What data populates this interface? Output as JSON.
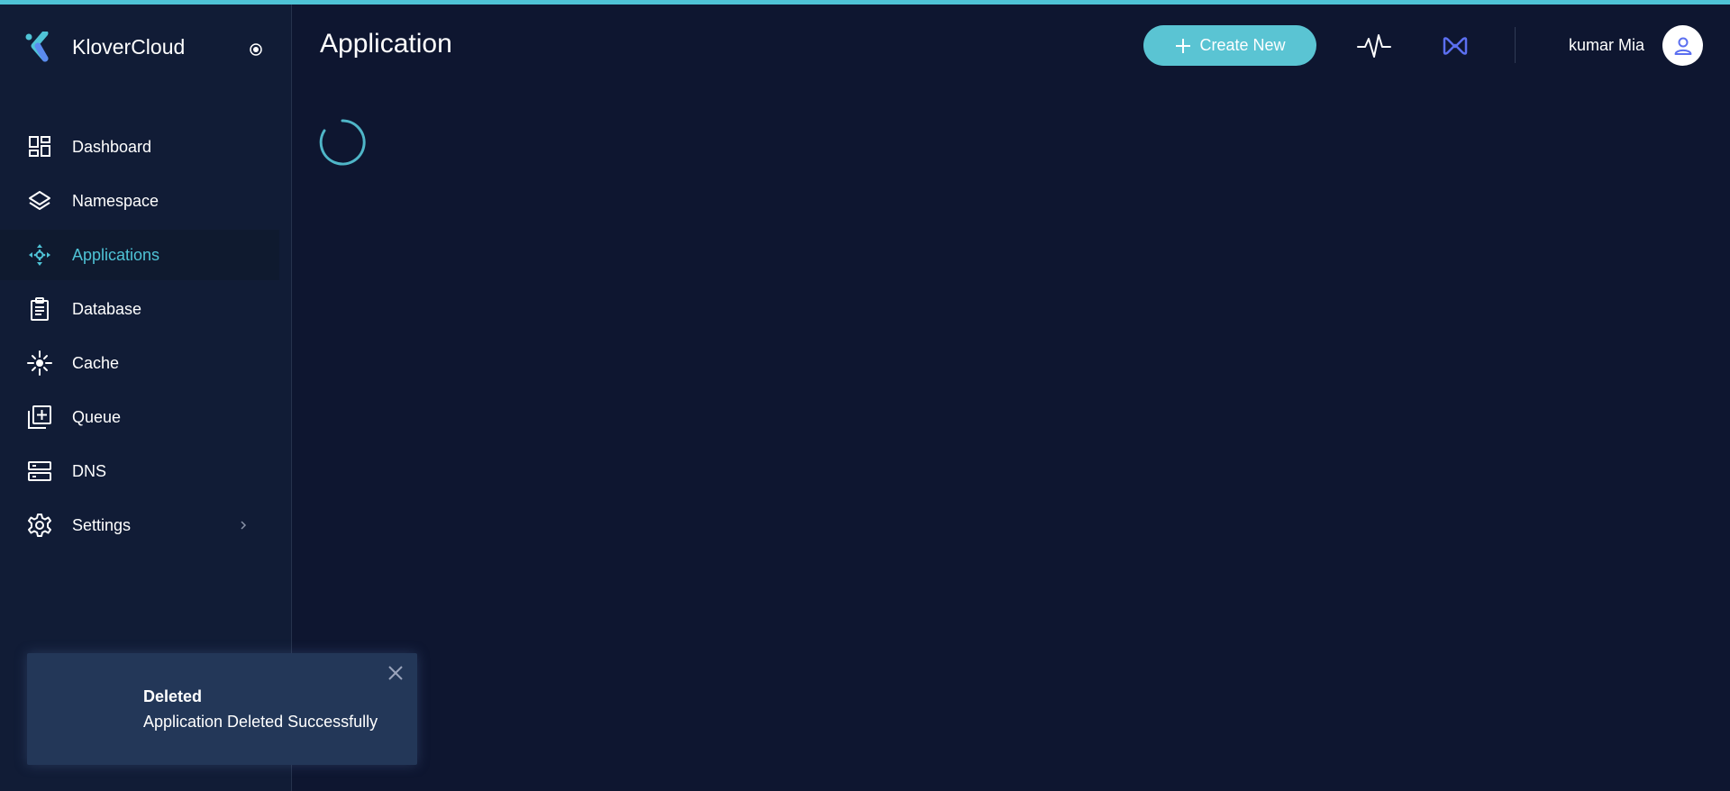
{
  "brand": {
    "name": "KloverCloud"
  },
  "sidebar": {
    "items": [
      {
        "label": "Dashboard",
        "icon": "dashboard-icon",
        "active": false
      },
      {
        "label": "Namespace",
        "icon": "layers-icon",
        "active": false
      },
      {
        "label": "Applications",
        "icon": "applications-icon",
        "active": true
      },
      {
        "label": "Database",
        "icon": "clipboard-icon",
        "active": false
      },
      {
        "label": "Cache",
        "icon": "sparkle-icon",
        "active": false
      },
      {
        "label": "Queue",
        "icon": "queue-icon",
        "active": false
      },
      {
        "label": "DNS",
        "icon": "server-icon",
        "active": false
      },
      {
        "label": "Settings",
        "icon": "gear-icon",
        "active": false,
        "has_submenu": true
      }
    ]
  },
  "header": {
    "title": "Application",
    "create_label": "Create New",
    "user_name": "kumar Mia"
  },
  "toast": {
    "title": "Deleted",
    "message": "Application Deleted Successfully"
  },
  "colors": {
    "accent": "#4fc3d6",
    "button": "#5ac4d3",
    "background": "#0e1630",
    "sidebar": "#111c36",
    "toast": "#233758",
    "infinity": "#5b6ff0"
  }
}
